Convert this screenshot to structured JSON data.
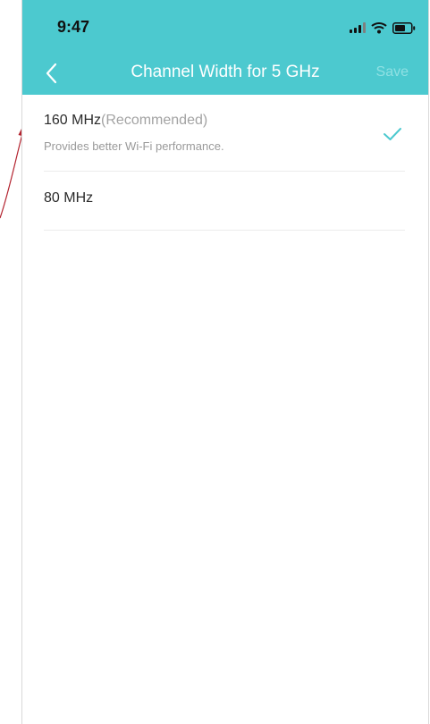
{
  "status_bar": {
    "time": "9:47"
  },
  "nav": {
    "title": "Channel Width for 5 GHz",
    "save_label": "Save",
    "back_icon": "chevron-left-icon"
  },
  "options": [
    {
      "label": "160 MHz",
      "tag": "(Recommended)",
      "description": "Provides better Wi-Fi performance.",
      "selected": true
    },
    {
      "label": "80 MHz",
      "selected": false
    }
  ],
  "colors": {
    "header": "#4cc9cf",
    "accent": "#4cc9cf",
    "annotation_arrow": "#b3232f"
  }
}
